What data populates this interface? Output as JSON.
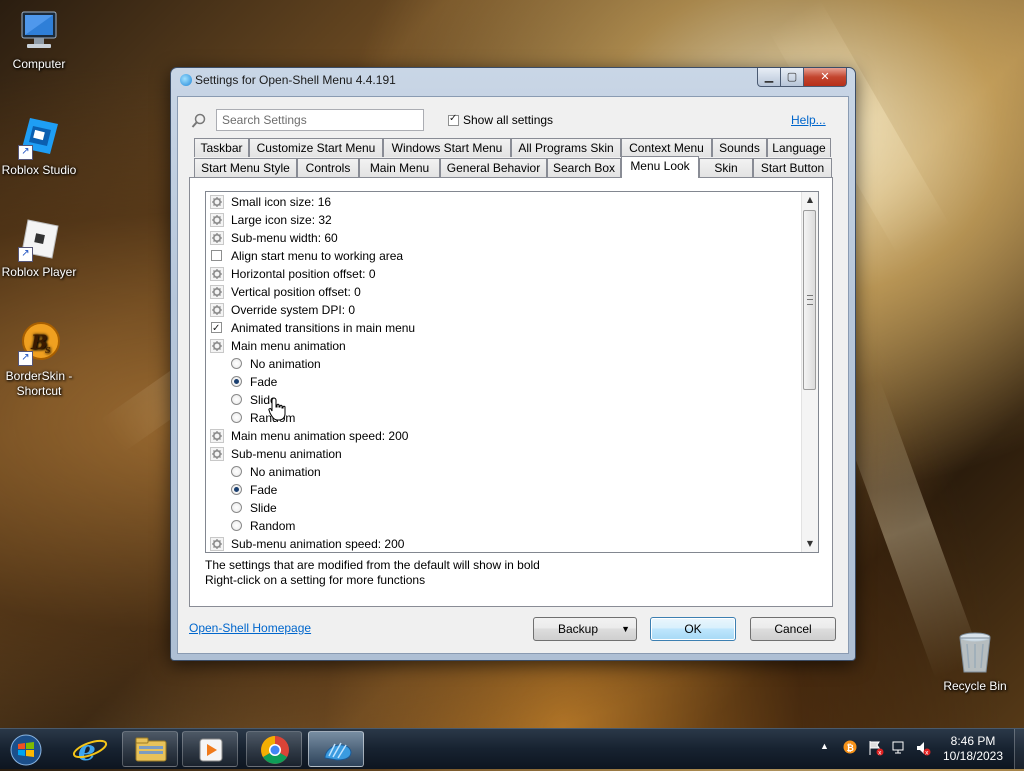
{
  "desktop": {
    "icons": [
      {
        "label": "Computer"
      },
      {
        "label": "Roblox Studio"
      },
      {
        "label": "Roblox Player"
      },
      {
        "label": "BorderSkin - Shortcut"
      },
      {
        "label": "Recycle Bin"
      }
    ]
  },
  "window": {
    "title": "Settings for Open-Shell Menu 4.4.191",
    "search_placeholder": "Search Settings",
    "show_all_label": "Show all settings",
    "show_all_checked": true,
    "help_link": "Help...",
    "tabs_row1": [
      "Taskbar",
      "Customize Start Menu",
      "Windows Start Menu",
      "All Programs Skin",
      "Context Menu",
      "Sounds",
      "Language"
    ],
    "tabs_row2": [
      "Start Menu Style",
      "Controls",
      "Main Menu",
      "General Behavior",
      "Search Box",
      "Menu Look",
      "Skin",
      "Start Button"
    ],
    "active_tab": "Menu Look",
    "settings": [
      {
        "kind": "gear",
        "text": "Small icon size: 16"
      },
      {
        "kind": "gear",
        "text": "Large icon size: 32"
      },
      {
        "kind": "gear",
        "text": "Sub-menu width: 60"
      },
      {
        "kind": "checkbox",
        "checked": false,
        "text": "Align start menu to working area"
      },
      {
        "kind": "gear",
        "text": "Horizontal position offset: 0"
      },
      {
        "kind": "gear",
        "text": "Vertical position offset: 0"
      },
      {
        "kind": "gear",
        "text": "Override system DPI: 0"
      },
      {
        "kind": "checkbox",
        "checked": true,
        "text": "Animated transitions in main menu"
      },
      {
        "kind": "gear",
        "text": "Main menu animation"
      },
      {
        "kind": "radio",
        "checked": false,
        "text": "No animation"
      },
      {
        "kind": "radio",
        "checked": true,
        "text": "Fade"
      },
      {
        "kind": "radio",
        "checked": false,
        "text": "Slide"
      },
      {
        "kind": "radio",
        "checked": false,
        "text": "Random"
      },
      {
        "kind": "gear",
        "text": "Main menu animation speed: 200"
      },
      {
        "kind": "gear",
        "text": "Sub-menu animation"
      },
      {
        "kind": "radio",
        "checked": false,
        "text": "No animation"
      },
      {
        "kind": "radio",
        "checked": true,
        "text": "Fade"
      },
      {
        "kind": "radio",
        "checked": false,
        "text": "Slide"
      },
      {
        "kind": "radio",
        "checked": false,
        "text": "Random"
      },
      {
        "kind": "gear",
        "text": "Sub-menu animation speed: 200"
      }
    ],
    "hint_line1": "The settings that are modified from the default will show in bold",
    "hint_line2": "Right-click on a setting for more functions",
    "homepage_link": "Open-Shell Homepage",
    "backup_button": "Backup",
    "ok_button": "OK",
    "cancel_button": "Cancel"
  },
  "taskbar": {
    "time": "8:46 PM",
    "date": "10/18/2023"
  }
}
